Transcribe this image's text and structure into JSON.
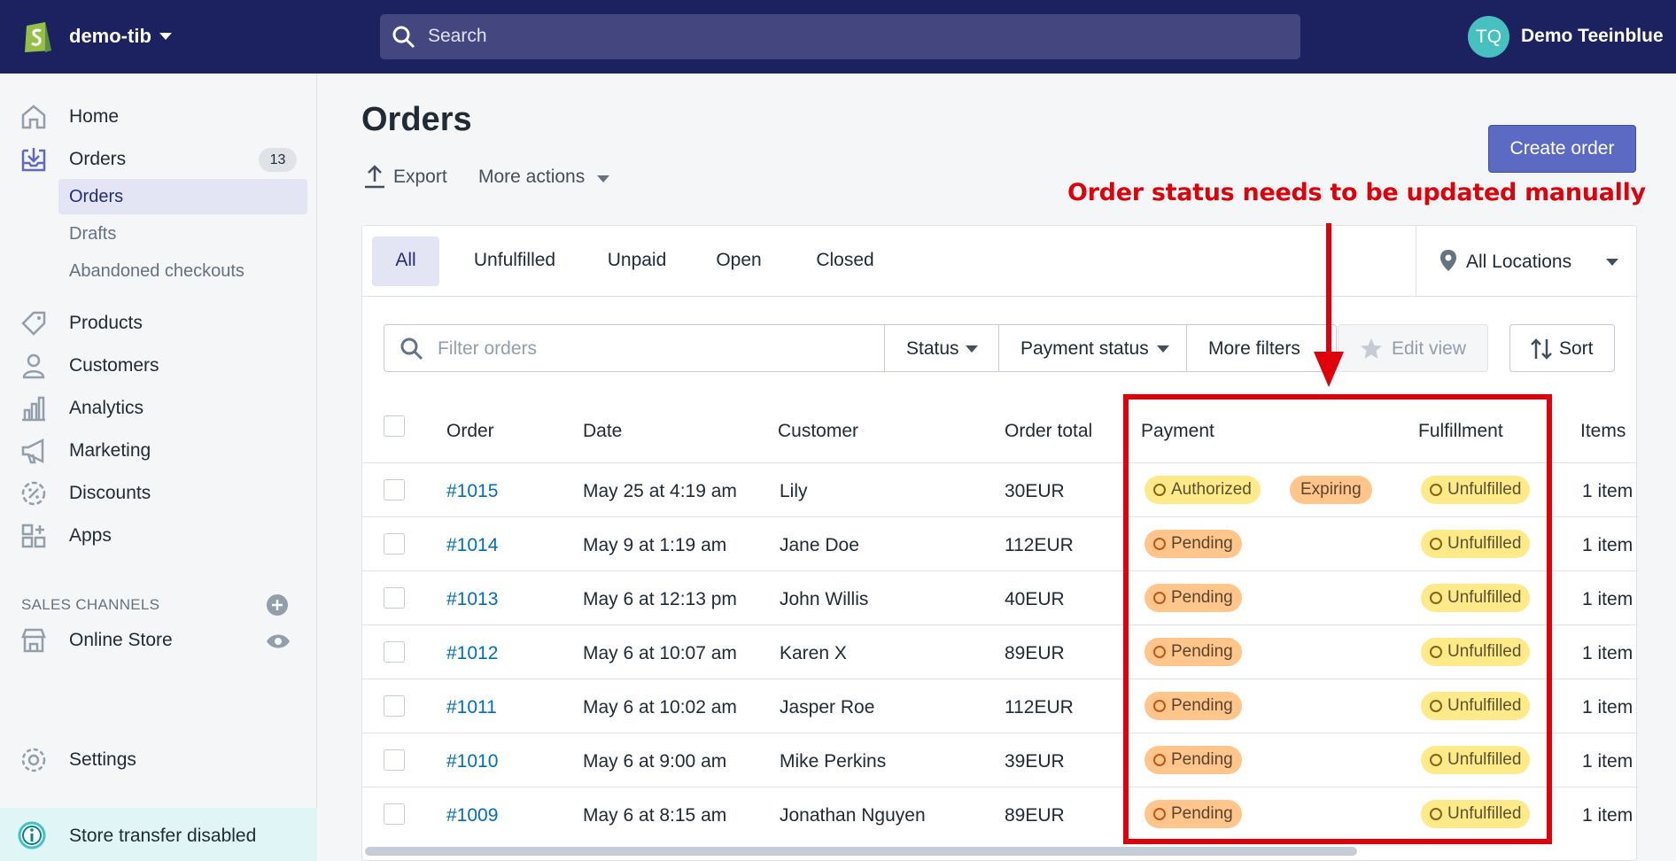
{
  "topbar": {
    "store_name": "demo-tib",
    "search_placeholder": "Search",
    "avatar_initials": "TQ",
    "user_name": "Demo Teeinblue"
  },
  "sidebar": {
    "items": [
      {
        "label": "Home",
        "icon": "home-icon"
      },
      {
        "label": "Orders",
        "icon": "orders-icon",
        "badge": "13"
      },
      {
        "label": "Products",
        "icon": "tag-icon"
      },
      {
        "label": "Customers",
        "icon": "person-icon"
      },
      {
        "label": "Analytics",
        "icon": "bar-chart-icon"
      },
      {
        "label": "Marketing",
        "icon": "megaphone-icon"
      },
      {
        "label": "Discounts",
        "icon": "discount-icon"
      },
      {
        "label": "Apps",
        "icon": "apps-icon"
      }
    ],
    "orders_sub": [
      "Orders",
      "Drafts",
      "Abandoned checkouts"
    ],
    "sales_channels_heading": "SALES CHANNELS",
    "online_store": "Online Store",
    "settings": "Settings",
    "store_transfer": "Store transfer disabled"
  },
  "page": {
    "title": "Orders",
    "export": "Export",
    "more_actions": "More actions",
    "create_order": "Create order"
  },
  "annotation": "Order status needs to be updated manually",
  "tabs": [
    "All",
    "Unfulfilled",
    "Unpaid",
    "Open",
    "Closed"
  ],
  "locations": "All Locations",
  "filters": {
    "placeholder": "Filter orders",
    "status": "Status",
    "payment_status": "Payment status",
    "more_filters": "More filters",
    "edit_view": "Edit view",
    "sort": "Sort"
  },
  "table": {
    "columns": [
      "Order",
      "Date",
      "Customer",
      "Order total",
      "Payment",
      "Fulfillment",
      "Items"
    ],
    "rows": [
      {
        "order": "#1015",
        "date": "May 25 at 4:19 am",
        "customer": "Lily",
        "total": "30EUR",
        "payment": "Authorized",
        "extra": "Expiring",
        "fulfillment": "Unfulfilled",
        "items": "1 item"
      },
      {
        "order": "#1014",
        "date": "May 9 at 1:19 am",
        "customer": "Jane Doe",
        "total": "112EUR",
        "payment": "Pending",
        "extra": "",
        "fulfillment": "Unfulfilled",
        "items": "1 item"
      },
      {
        "order": "#1013",
        "date": "May 6 at 12:13 pm",
        "customer": "John Willis",
        "total": "40EUR",
        "payment": "Pending",
        "extra": "",
        "fulfillment": "Unfulfilled",
        "items": "1 item"
      },
      {
        "order": "#1012",
        "date": "May 6 at 10:07 am",
        "customer": "Karen X",
        "total": "89EUR",
        "payment": "Pending",
        "extra": "",
        "fulfillment": "Unfulfilled",
        "items": "1 item"
      },
      {
        "order": "#1011",
        "date": "May 6 at 10:02 am",
        "customer": "Jasper Roe",
        "total": "112EUR",
        "payment": "Pending",
        "extra": "",
        "fulfillment": "Unfulfilled",
        "items": "1 item"
      },
      {
        "order": "#1010",
        "date": "May 6 at 9:00 am",
        "customer": "Mike Perkins",
        "total": "39EUR",
        "payment": "Pending",
        "extra": "",
        "fulfillment": "Unfulfilled",
        "items": "1 item"
      },
      {
        "order": "#1009",
        "date": "May 6 at 8:15 am",
        "customer": "Jonathan Nguyen",
        "total": "89EUR",
        "payment": "Pending",
        "extra": "",
        "fulfillment": "Unfulfilled",
        "items": "1 item"
      }
    ]
  },
  "colors": {
    "topbar": "#1c2260",
    "primary": "#5c6ac4",
    "annotation": "#e0000a",
    "link": "#006fbb"
  }
}
